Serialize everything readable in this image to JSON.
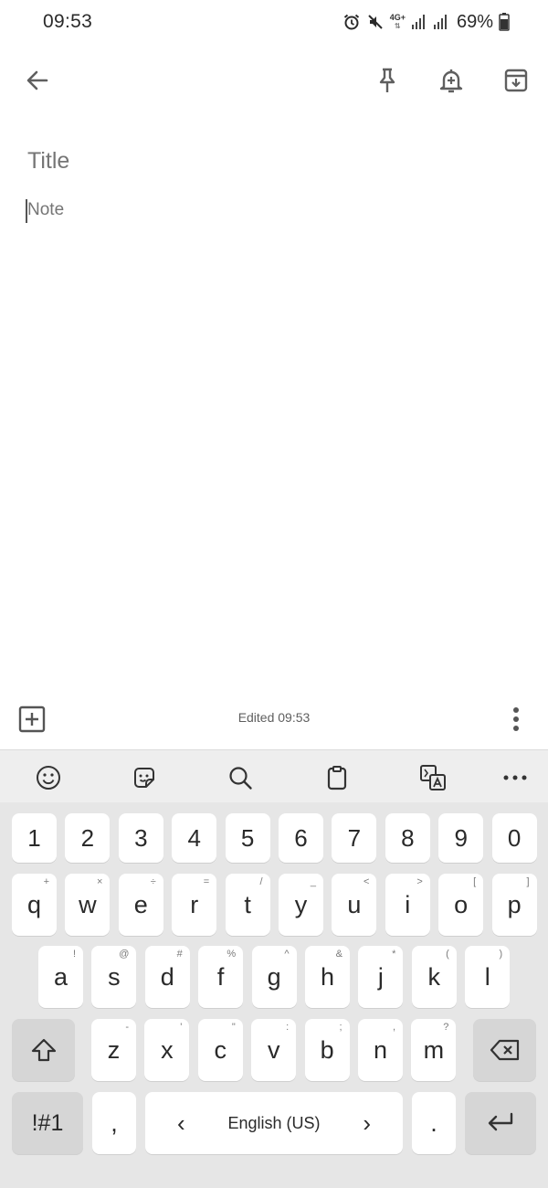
{
  "status_bar": {
    "time": "09:53",
    "network_label": "4G+",
    "battery": "69%",
    "icons": [
      "alarm-icon",
      "mute-icon",
      "network-4g-icon",
      "signal-icon",
      "signal-icon",
      "battery-icon"
    ]
  },
  "toolbar": {
    "back": "back-arrow-icon",
    "pin": "pin-icon",
    "reminder": "reminder-bell-icon",
    "archive": "archive-icon"
  },
  "note": {
    "title_placeholder": "Title",
    "note_placeholder": "Note"
  },
  "bottom_bar": {
    "edited": "Edited 09:53"
  },
  "keyboard": {
    "toolbar": [
      "emoji-icon",
      "sticker-icon",
      "search-icon",
      "clipboard-icon",
      "translate-icon",
      "more-dots-icon"
    ],
    "row_numbers": [
      "1",
      "2",
      "3",
      "4",
      "5",
      "6",
      "7",
      "8",
      "9",
      "0"
    ],
    "row_q": [
      {
        "k": "q",
        "s": "+"
      },
      {
        "k": "w",
        "s": "×"
      },
      {
        "k": "e",
        "s": "÷"
      },
      {
        "k": "r",
        "s": "="
      },
      {
        "k": "t",
        "s": "/"
      },
      {
        "k": "y",
        "s": "_"
      },
      {
        "k": "u",
        "s": "<"
      },
      {
        "k": "i",
        "s": ">"
      },
      {
        "k": "o",
        "s": "["
      },
      {
        "k": "p",
        "s": "]"
      }
    ],
    "row_a": [
      {
        "k": "a",
        "s": "!"
      },
      {
        "k": "s",
        "s": "@"
      },
      {
        "k": "d",
        "s": "#"
      },
      {
        "k": "f",
        "s": "%"
      },
      {
        "k": "g",
        "s": "^"
      },
      {
        "k": "h",
        "s": "&"
      },
      {
        "k": "j",
        "s": "*"
      },
      {
        "k": "k",
        "s": "("
      },
      {
        "k": "l",
        "s": ")"
      }
    ],
    "row_z": [
      {
        "k": "z",
        "s": "-"
      },
      {
        "k": "x",
        "s": "'"
      },
      {
        "k": "c",
        "s": "\""
      },
      {
        "k": "v",
        "s": ":"
      },
      {
        "k": "b",
        "s": ";"
      },
      {
        "k": "n",
        "s": ","
      },
      {
        "k": "m",
        "s": "?"
      }
    ],
    "symbols_key": "!#1",
    "comma_key": ",",
    "space_left": "‹",
    "space_label": "English (US)",
    "space_right": "›",
    "period_key": "."
  },
  "colors": {
    "keyboard_bg": "#e6e6e6",
    "key_bg": "#ffffff",
    "dark_key_bg": "#d6d6d6"
  }
}
